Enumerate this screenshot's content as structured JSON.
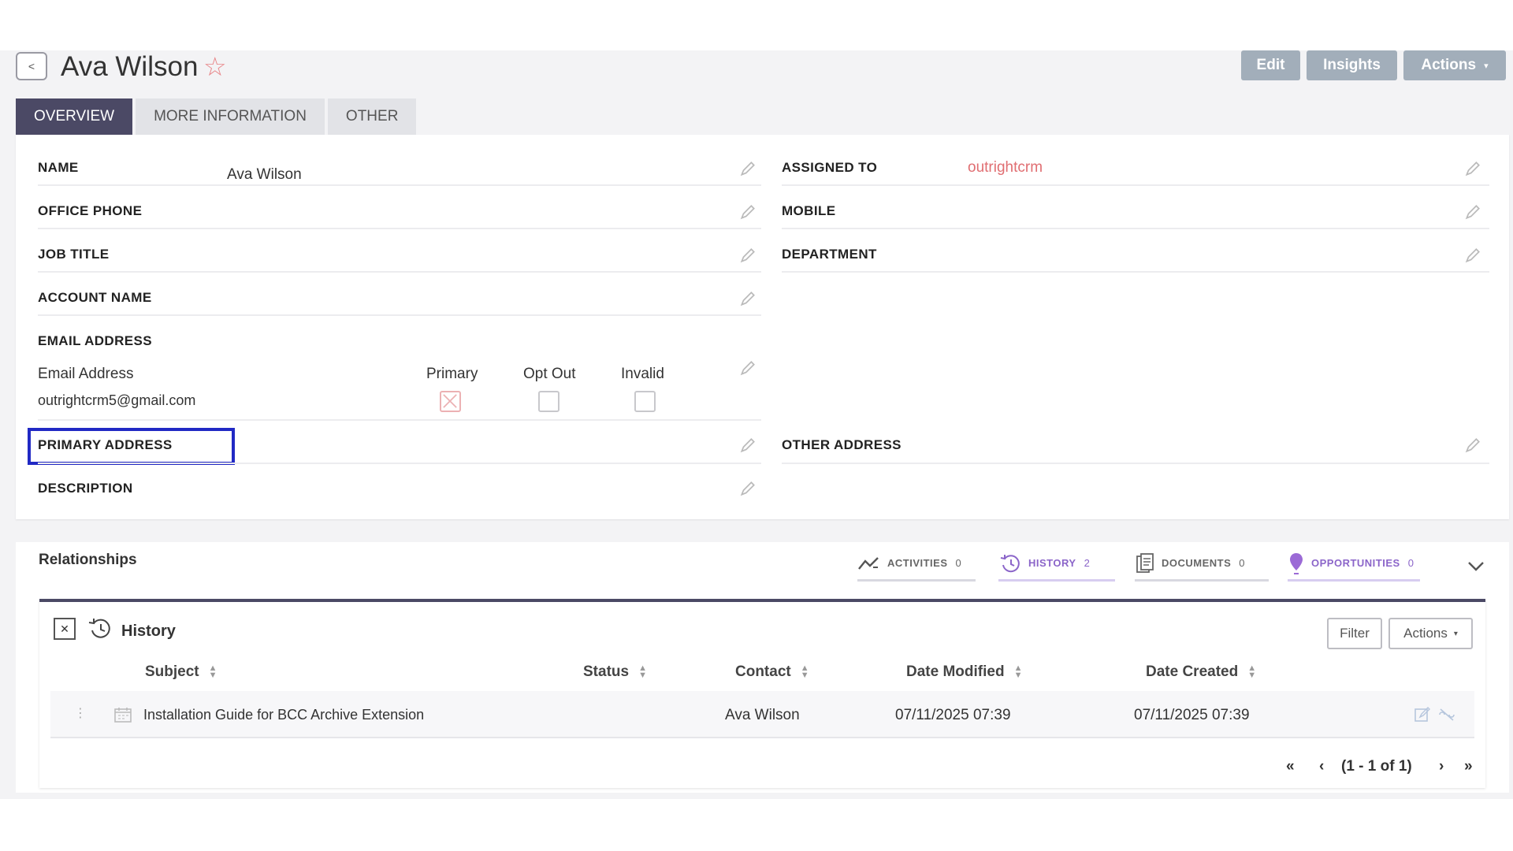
{
  "header": {
    "title": "Ava Wilson",
    "buttons": {
      "edit": "Edit",
      "insights": "Insights",
      "actions": "Actions"
    }
  },
  "tabs": [
    "OVERVIEW",
    "MORE INFORMATION",
    "OTHER"
  ],
  "fields": {
    "name": {
      "label": "NAME",
      "value": "Ava Wilson"
    },
    "office_phone": {
      "label": "OFFICE PHONE",
      "value": ""
    },
    "job_title": {
      "label": "JOB TITLE",
      "value": ""
    },
    "account_name": {
      "label": "ACCOUNT NAME",
      "value": ""
    },
    "email_address": {
      "label": "EMAIL ADDRESS"
    },
    "primary_address": {
      "label": "PRIMARY ADDRESS",
      "value": ""
    },
    "description": {
      "label": "DESCRIPTION",
      "value": ""
    },
    "assigned_to": {
      "label": "ASSIGNED TO",
      "value": "outrightcrm"
    },
    "mobile": {
      "label": "MOBILE",
      "value": ""
    },
    "department": {
      "label": "DEPARTMENT",
      "value": ""
    },
    "other_address": {
      "label": "OTHER ADDRESS",
      "value": ""
    }
  },
  "email": {
    "col_address": "Email Address",
    "col_primary": "Primary",
    "col_optout": "Opt Out",
    "col_invalid": "Invalid",
    "value": "outrightcrm5@gmail.com",
    "primary": true,
    "opt_out": false,
    "invalid": false
  },
  "relationships": {
    "title": "Relationships",
    "tabs": [
      {
        "label": "ACTIVITIES",
        "count": "0",
        "icon": "activity-chart-icon"
      },
      {
        "label": "HISTORY",
        "count": "2",
        "icon": "history-icon"
      },
      {
        "label": "DOCUMENTS",
        "count": "0",
        "icon": "documents-icon"
      },
      {
        "label": "OPPORTUNITIES",
        "count": "0",
        "icon": "opportunity-pin-icon"
      }
    ]
  },
  "history": {
    "title": "History",
    "filter_label": "Filter",
    "actions_label": "Actions",
    "columns": [
      "Subject",
      "Status",
      "Contact",
      "Date Modified",
      "Date Created"
    ],
    "rows": [
      {
        "subject": "Installation Guide for BCC Archive Extension",
        "status": "",
        "contact": "Ava Wilson",
        "date_modified": "07/11/2025 07:39",
        "date_created": "07/11/2025 07:39"
      }
    ],
    "pagination": {
      "first": "«",
      "prev": "‹",
      "info": "(1 - 1 of 1)",
      "next": "›",
      "last": "»"
    }
  },
  "colors": {
    "accent_dark": "#4b4965",
    "link_red": "#e06e72",
    "button_grey": "#a2aeba",
    "highlight_blue": "#2129c4"
  }
}
